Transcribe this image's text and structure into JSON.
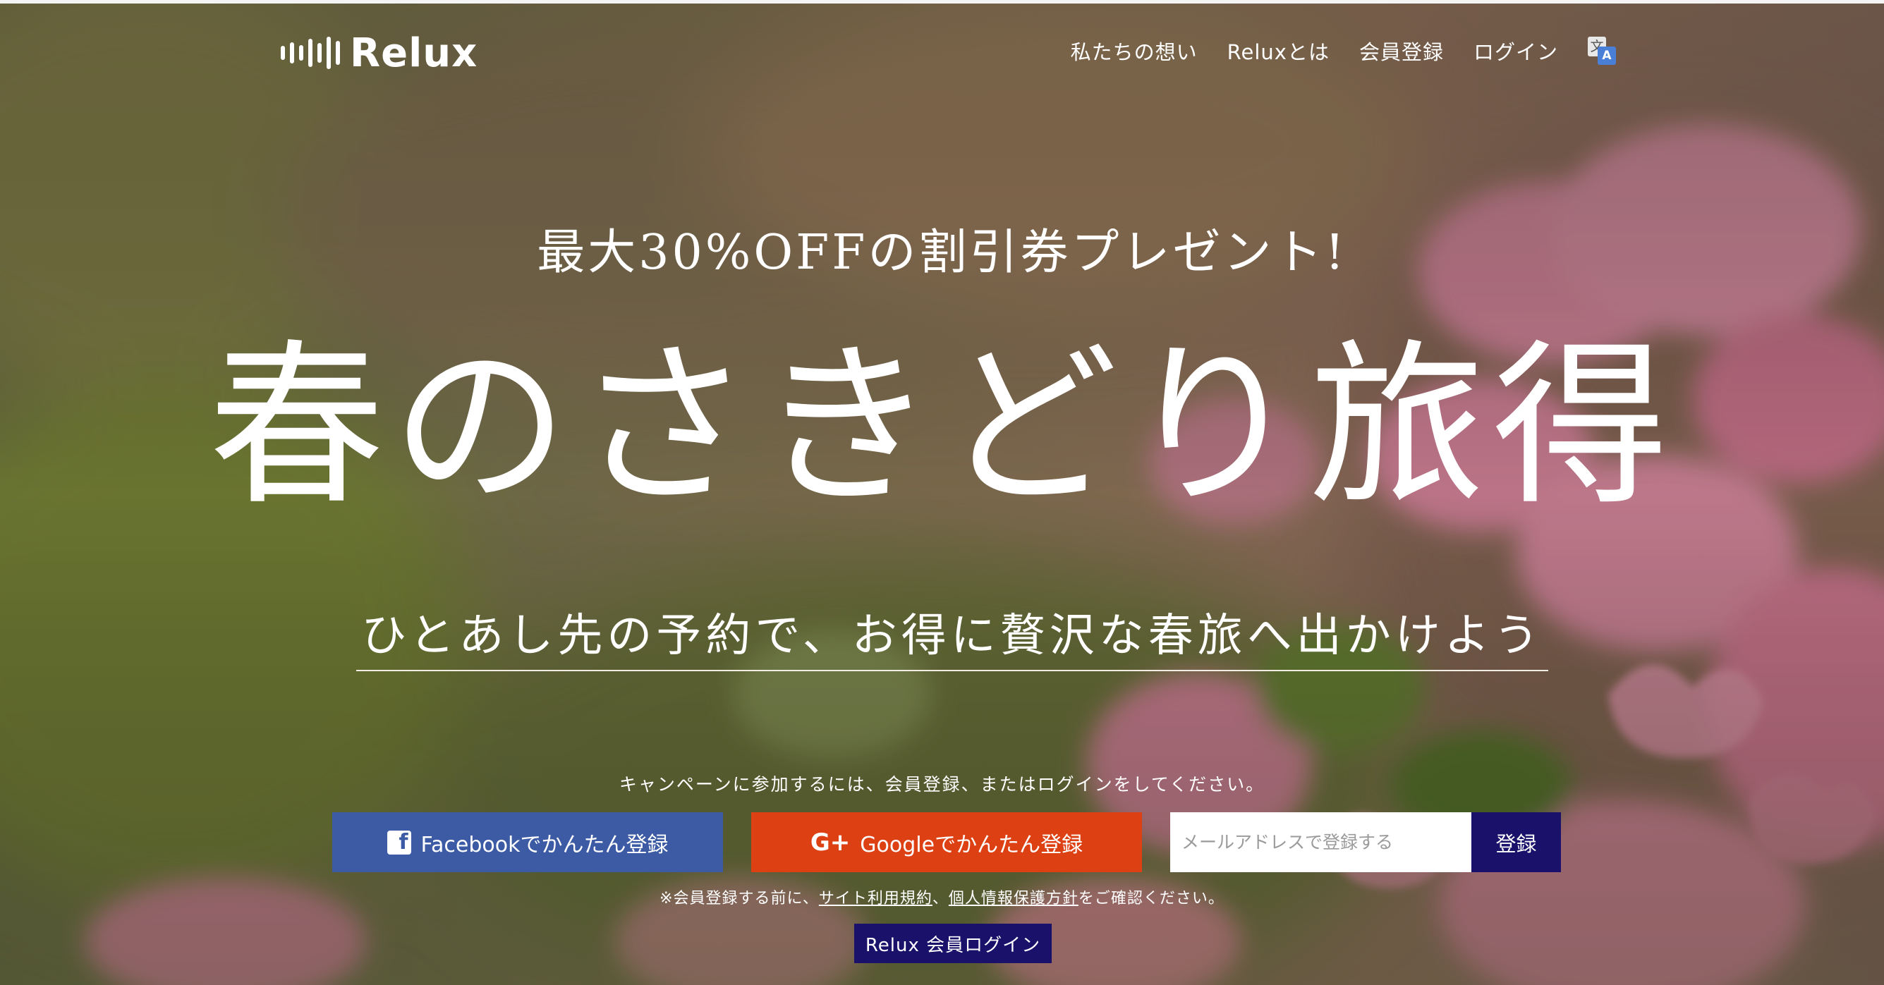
{
  "brand": {
    "logo_text": "Relux"
  },
  "nav": {
    "items": [
      {
        "label": "私たちの想い"
      },
      {
        "label": "Reluxとは"
      },
      {
        "label": "会員登録"
      },
      {
        "label": "ログイン"
      }
    ],
    "language_icon": "translate-icon"
  },
  "hero": {
    "subtitle": "最大30%OFFの割引券プレゼント!",
    "title": "春のさきどり旅得",
    "tagline": "ひとあし先の予約で、お得に贅沢な春旅へ出かけよう"
  },
  "signup": {
    "instruction": "キャンペーンに参加するには、会員登録、またはログインをしてください。",
    "facebook_label": "Facebookでかんたん登録",
    "google_label": "Googleでかんたん登録",
    "email_placeholder": "メールアドレスで登録する",
    "register_label": "登録",
    "notice_prefix": "※会員登録する前に、",
    "terms_link": "サイト利用規約",
    "notice_sep": "、",
    "privacy_link": "個人情報保護方針",
    "notice_suffix": "をご確認ください。",
    "login_label": "Relux 会員ログイン"
  },
  "colors": {
    "facebook": "#3c5ba4",
    "google": "#dd4113",
    "navy": "#19116a",
    "flower_pink": "#e99ab0"
  }
}
